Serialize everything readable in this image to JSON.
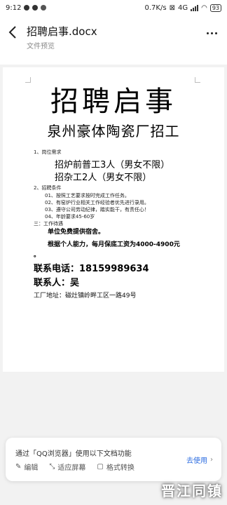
{
  "status_bar": {
    "time": "9:12",
    "speed": "0.7K/s",
    "network": "4G",
    "battery": "93"
  },
  "header": {
    "title": "招聘启事.docx",
    "subtitle": "文件预览"
  },
  "document": {
    "headline": "招聘启事",
    "company": "泉州豪体陶瓷厂招工",
    "section1_title": "1、岗位需求",
    "positions": [
      "招炉前普工3人（男女不限）",
      "招杂工2人（男女不限）"
    ],
    "section2_title": "2、招聘条件",
    "requirements": [
      "01、按照工艺要求按时完成工作任务。",
      "02、有窑炉行业相关工作经验者优先进行录用。",
      "03、遵守公司劳动纪律，踏实能干，有责任心！",
      "04、年龄要求45-60岁"
    ],
    "section3_title": "三：工作待遇",
    "benefit1": "单位免费提供宿舍。",
    "benefit2": "根据个人能力，每月保底工资为4000-4900元",
    "period": "。",
    "phone_line": "联系电话：18159989634",
    "contact_line": "联系人：吴",
    "address": "工厂地址：磁灶镇岭畔工区一路49号"
  },
  "bottom_sheet": {
    "title": "通过「QQ浏览器」使用以下文档功能",
    "items": [
      "编辑",
      "适应屏幕",
      "格式转换"
    ],
    "cta": "去使用"
  },
  "watermark": "晋江同镇"
}
